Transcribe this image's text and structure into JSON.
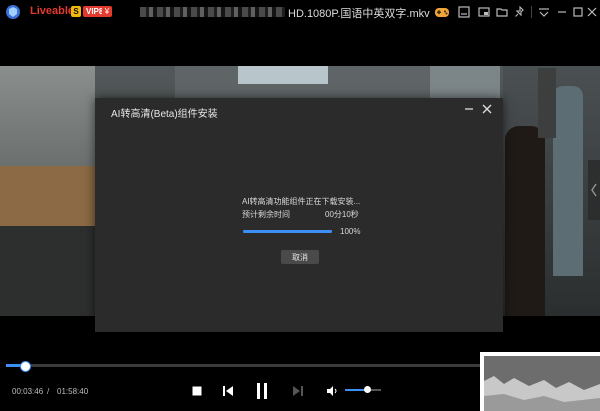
{
  "app": {
    "brand": "Liveable",
    "badge_s": "S",
    "badge_vip": "VIP8",
    "badge_extra": "¥",
    "file_title": "HD.1080P.国语中英双字.mkv"
  },
  "titlebar_icons": [
    "gamepad-icon",
    "minimize-mode-icon",
    "picture-in-picture-icon",
    "folder-icon",
    "pin-icon",
    "menu-icon",
    "minimize-icon",
    "maximize-icon",
    "close-icon"
  ],
  "dialog": {
    "title": "AI转高清(Beta)组件安装",
    "message": "AI转高清功能组件正在下载安装...",
    "remaining_label": "预计剩余时间",
    "remaining_value": "00分10秒",
    "progress": 1.0,
    "percent": "100%",
    "cancel_label": "取消"
  },
  "player": {
    "current_time": "00:03:46",
    "separator": "/",
    "total_time": "01:58:40",
    "seek_progress": 0.032,
    "volume": 0.6
  },
  "colors": {
    "accent": "#3d8ff5",
    "brand": "#e23a2f",
    "dialog_bg": "#2b2b2b"
  }
}
